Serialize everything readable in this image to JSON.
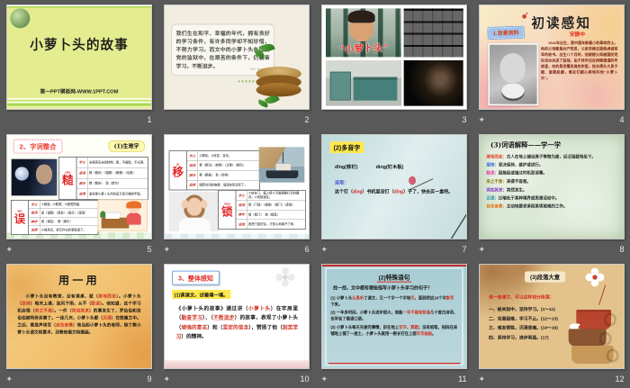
{
  "app": {
    "canvas_color": "#595959",
    "accent_red": "#d03020",
    "star_icon": "✦"
  },
  "slides": [
    {
      "num": "1",
      "title": "小萝卜头的故事",
      "footer": "第一PPT模板网-WWW.1PPT.COM"
    },
    {
      "num": "2",
      "body": "我们生在和平、幸福的年代，拥有良好的学习条件，有许多同学却不知珍惜，不努力学习。而文中的小萝卜头在国民党的监狱中，在艰苦的条件下，仍勤奋学习，不断进步。",
      "watermark": "For Your natural beauty"
    },
    {
      "num": "3",
      "poster_caption": "“小萝卜头”"
    },
    {
      "num": "4",
      "title": "初读感知",
      "label": "1.背景资料",
      "person": "宋振中",
      "bio": "1941年出生，是中国年龄最小的革命烈士。他的父母都是共产党员，父亲宋绮云是杨虎城将军的秘书。出生八个月时，他就随父母被国民党反动派关进了监狱。由于终年住在阴暗潮湿的牢房里，吃的是发霉发臭的牢饭，他长得头大身子细、面黄肌瘦，难友们都心疼地叫他“小萝卜头”。"
    },
    {
      "num": "5",
      "title": "2、字词整合",
      "label": "(1)生难字",
      "tables": [
        {
          "char": "糙",
          "pinyin": "cāo",
          "rows": [
            {
              "k": "字义",
              "v": "米脱壳后未经精制；粗，不细致，不光滑。"
            },
            {
              "k": "组词",
              "v": "糙（糙米）（粗糙）（糙粮）（毛糙）"
            },
            {
              "k": "辨字",
              "v": "糙（糙米）　造（造句）"
            },
            {
              "k": "运用",
              "v": "监狱里小萝卜头吃的是又霉又糙的牢饭。"
            }
          ]
        },
        {
          "char": "误",
          "pinyin": "wù",
          "rows": [
            {
              "k": "字义",
              "v": "①错误；②耽搁；③使受损害。"
            },
            {
              "k": "组词",
              "v": "误（误解）（误会）（误点）（误事）"
            },
            {
              "k": "辨字",
              "v": "误（误会）　娱（娱乐）"
            },
            {
              "k": "运用",
              "v": "小强贪玩，把写作业的事耽误了。"
            }
          ]
        }
      ]
    },
    {
      "num": "6",
      "tables": [
        {
          "char": "移",
          "pinyin": "yí",
          "rows": [
            {
              "k": "字义",
              "v": "①挪动；②改变，变动。"
            },
            {
              "k": "组词",
              "v": "移（移动）（转移）（迁移）（移民）"
            },
            {
              "k": "辨字",
              "v": "移（移植）　秒（秒钟）"
            },
            {
              "k": "运用",
              "v": "随着时间的推移，局面有所改变了。"
            }
          ]
        },
        {
          "char": "锁",
          "pinyin": "suǒ",
          "rows": [
            {
              "k": "字义",
              "v": "①安在门、箱上使人不能随便打开的器具；②用锁锁住。"
            },
            {
              "k": "组词",
              "v": "锁（门锁）（枷锁）（锁门）（连锁）"
            },
            {
              "k": "辨字",
              "v": "锁（锁门）　销（销售）"
            },
            {
              "k": "运用",
              "v": "她把门锁好后，才放心地离开了家。"
            }
          ]
        }
      ]
    },
    {
      "num": "7",
      "title": "(2)多音字",
      "readings": [
        "dīng(铁钉)",
        "dìng(钉木板)"
      ],
      "usage_label": "运用：",
      "sentence": [
        {
          "t": "这个钉（"
        },
        {
          "t": "dìng",
          "c": "#e02020"
        },
        {
          "t": "）书机里没钉（"
        },
        {
          "t": "dīng",
          "c": "#e02020"
        },
        {
          "t": "）子了，快去买一盒吧。"
        }
      ]
    },
    {
      "num": "8",
      "title": "(3)词语解释——学一学",
      "entries": [
        [
          {
            "t": "席地而坐：",
            "c": "#e04020",
            "b": 1
          },
          {
            "t": "古人在地上铺设席子等物为座，后泛指就地坐下。"
          }
        ],
        [
          {
            "t": "坚持：",
            "c": "#2858d8",
            "b": 1
          },
          {
            "t": "坚决保持、维护或进行。"
          }
        ],
        [
          {
            "t": "耽误：",
            "c": "#e0309a",
            "b": 1
          },
          {
            "t": "因拖延或错过时机而误事。"
          }
        ],
        [
          {
            "t": "来之不易：",
            "c": "#887800",
            "b": 1
          },
          {
            "t": "来得不容易。"
          }
        ],
        [
          {
            "t": "突如其来：",
            "c": "#8030c0",
            "b": 1
          },
          {
            "t": "突然发生。"
          }
        ],
        [
          {
            "t": "沉浸：",
            "c": "#2090a8",
            "b": 1
          },
          {
            "t": "比喻处于某种境界或思想活动中。"
          }
        ],
        [
          {
            "t": "自告奋勇：",
            "c": "#e07010",
            "b": 1
          },
          {
            "t": "主动地要求承担某项艰难的工作。"
          }
        ]
      ]
    },
    {
      "num": "9",
      "title": "用一用",
      "paragraph": [
        {
          "t": "小萝卜头没有教室，没有课桌，就（"
        },
        {
          "t": "席地而坐",
          "c": "#d03020"
        },
        {
          "t": "）。小萝卜头（"
        },
        {
          "t": "坚持",
          "c": "#d03020"
        },
        {
          "t": "）每天上课，刮风下雨，从不（"
        },
        {
          "t": "耽误",
          "c": "#d03020"
        },
        {
          "t": "）。他知道，这个学习机会很（"
        },
        {
          "t": "来之不易",
          "c": "#d03020"
        },
        {
          "t": "）。一件（"
        },
        {
          "t": "突如其来",
          "c": "#d03020"
        },
        {
          "t": "）的事发生了，罗伯伯和张伯伯被特务杀害了。一连几天，小萝卜头都（"
        },
        {
          "t": "沉浸",
          "c": "#d03020"
        },
        {
          "t": "）在悲痛之中。之后，黄显声将军（"
        },
        {
          "t": "自告奋勇",
          "c": "#d03020"
        },
        {
          "t": "）地当起小萝卜头的老师，除了教小萝卜头语文和算术，还教他俄文和图画。"
        }
      ]
    },
    {
      "num": "10",
      "heading": "3、整体感知",
      "sub": "(1)读课文，试着填一填。",
      "paragraph": [
        {
          "t": "《小萝卜头的故事》通过讲（"
        },
        {
          "t": "小萝卜头",
          "c": "#d03020"
        },
        {
          "t": "）在牢房里（"
        },
        {
          "t": "勤奋学习",
          "c": "#d03020",
          "u": 1
        },
        {
          "t": "）、（"
        },
        {
          "t": "不断进步",
          "c": "#d03020",
          "u": 1
        },
        {
          "t": "）的故事，表现了小萝卜头（"
        },
        {
          "t": "顽强的意志",
          "c": "#d03020"
        },
        {
          "t": "）和（"
        },
        {
          "t": "坚定的信念",
          "c": "#d03020"
        },
        {
          "t": "），赞扬了他（"
        },
        {
          "t": "刻苦学习",
          "c": "#d03020",
          "u": 1
        },
        {
          "t": "）的精神。"
        }
      ]
    },
    {
      "num": "11",
      "title": "(2)特殊语句",
      "question": "找一找，文中都有哪些描写小萝卜头学习的句子？",
      "items": [
        [
          {
            "t": "(1) 小萝卜头"
          },
          {
            "t": "认真听",
            "c": "#d03020"
          },
          {
            "t": "了课文，又一个字一个字地"
          },
          {
            "t": "写",
            "c": "#d03020"
          },
          {
            "t": "，直到把这16个字"
          },
          {
            "t": "默写",
            "c": "#d03020"
          },
          {
            "t": "下来。"
          }
        ],
        [
          {
            "t": "(2) 一年多时间，小萝卜头进步很大，他能"
          },
          {
            "t": "一字不错地背诵",
            "c": "#d03020"
          },
          {
            "t": "几十首古诗词，也学会了俄语口语。"
          }
        ],
        [
          {
            "t": "(3) 小萝卜头每天先做完事情，趴在地上"
          },
          {
            "t": "写字",
            "c": "#d03020"
          },
          {
            "t": "、"
          },
          {
            "t": "算题",
            "c": "#d03020"
          },
          {
            "t": "；没有纸笔，妈妈在床铺地上铺了一层土，小萝卜头就用一根长钉在上面"
          },
          {
            "t": "写写画画",
            "c": "#d03020"
          },
          {
            "t": "。"
          }
        ]
      ]
    },
    {
      "num": "12",
      "title": "(3)段落大意",
      "intro": "读一读课文，可以这样划分段落：",
      "lines": [
        "一、被关狱中，坚持学习。(1～11)",
        "二、克服困难，学习不止。(12～13)",
        "三、难友牺牲，沉浸悲痛。(14～16)",
        "四、坚持学习，进步明显。(17)"
      ]
    }
  ]
}
